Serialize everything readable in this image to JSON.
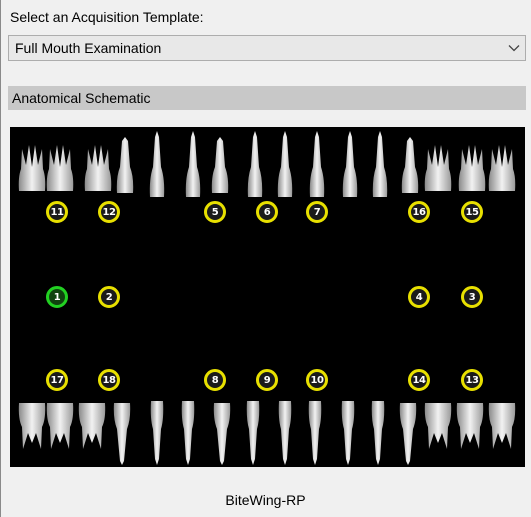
{
  "template": {
    "label": "Select an Acquisition Template:",
    "selected": "Full Mouth Examination"
  },
  "schematic": {
    "title": "Anatomical Schematic",
    "markers": [
      "11",
      "12",
      "5",
      "6",
      "7",
      "16",
      "15",
      "1",
      "2",
      "4",
      "3",
      "17",
      "18",
      "8",
      "9",
      "10",
      "14",
      "13"
    ],
    "active_marker": "1",
    "colors": {
      "marker_ring": "#e8e000",
      "active_ring": "#22d022"
    }
  },
  "footer": {
    "template_name": "BiteWing-RP"
  },
  "icons": {
    "dropdown": "chevron-down-icon"
  }
}
